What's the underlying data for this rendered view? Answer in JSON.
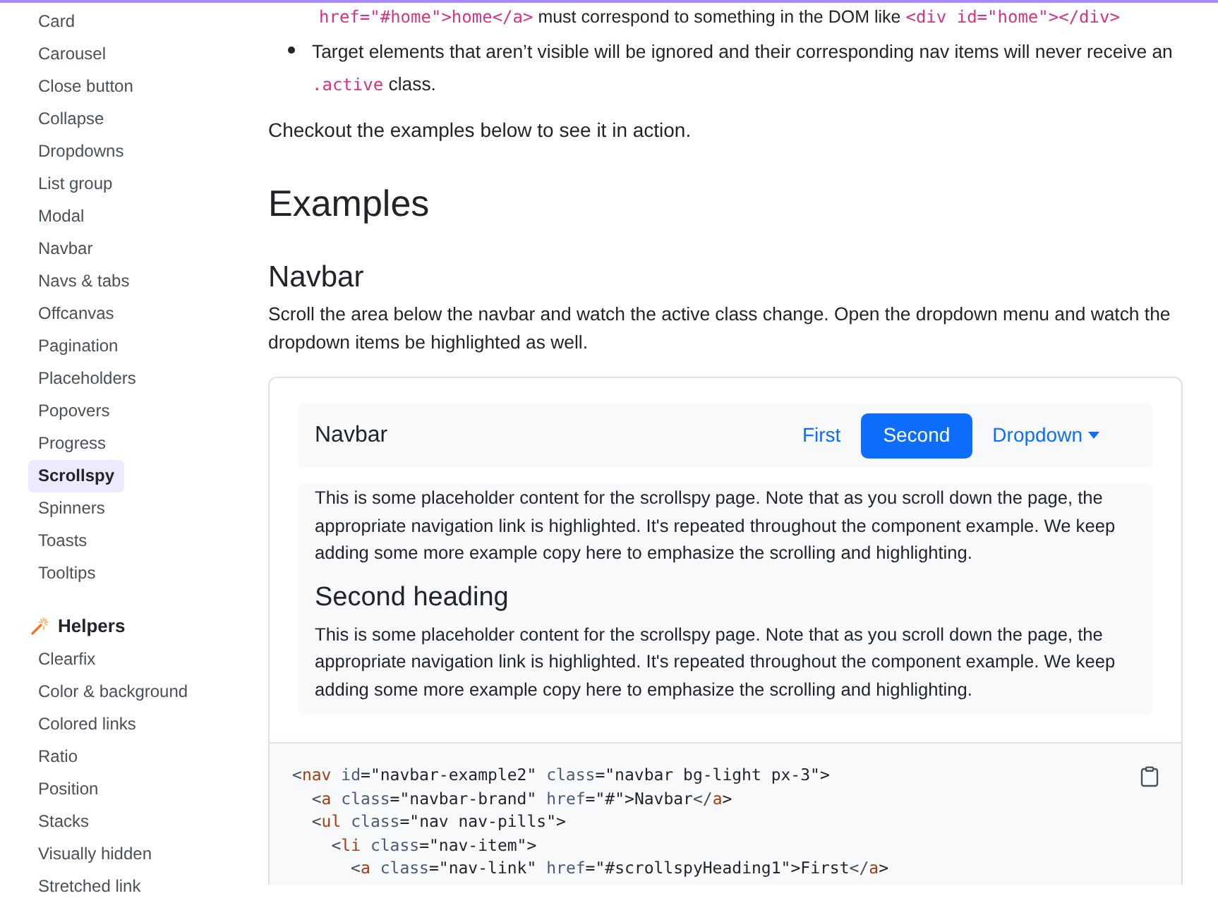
{
  "sidebar": {
    "items": [
      {
        "label": "Card",
        "selected": false
      },
      {
        "label": "Carousel",
        "selected": false
      },
      {
        "label": "Close button",
        "selected": false
      },
      {
        "label": "Collapse",
        "selected": false
      },
      {
        "label": "Dropdowns",
        "selected": false
      },
      {
        "label": "List group",
        "selected": false
      },
      {
        "label": "Modal",
        "selected": false
      },
      {
        "label": "Navbar",
        "selected": false
      },
      {
        "label": "Navs & tabs",
        "selected": false
      },
      {
        "label": "Offcanvas",
        "selected": false
      },
      {
        "label": "Pagination",
        "selected": false
      },
      {
        "label": "Placeholders",
        "selected": false
      },
      {
        "label": "Popovers",
        "selected": false
      },
      {
        "label": "Progress",
        "selected": false
      },
      {
        "label": "Scrollspy",
        "selected": true
      },
      {
        "label": "Spinners",
        "selected": false
      },
      {
        "label": "Toasts",
        "selected": false
      },
      {
        "label": "Tooltips",
        "selected": false
      }
    ],
    "section": {
      "title": "Helpers",
      "items": [
        {
          "label": "Clearfix",
          "selected": false
        },
        {
          "label": "Color & background",
          "selected": false
        },
        {
          "label": "Colored links",
          "selected": false
        },
        {
          "label": "Ratio",
          "selected": false
        },
        {
          "label": "Position",
          "selected": false
        },
        {
          "label": "Stacks",
          "selected": false
        },
        {
          "label": "Visually hidden",
          "selected": false
        },
        {
          "label": "Stretched link",
          "selected": false
        }
      ]
    }
  },
  "content": {
    "cut_line": [
      {
        "kind": "code",
        "text": "href=\"#home\">home</a>"
      },
      {
        "kind": "text",
        "text": " must correspond to something in the DOM like "
      },
      {
        "kind": "code",
        "text": "<div id=\"home\"></div>"
      }
    ],
    "bullet": [
      {
        "kind": "text",
        "text": "Target elements that aren’t visible will be ignored and their corresponding nav items will never receive an "
      },
      {
        "kind": "code",
        "text": ".active"
      },
      {
        "kind": "text",
        "text": " class."
      }
    ],
    "intro": "Checkout the examples below to see it in action.",
    "heading": "Examples",
    "subheading": "Navbar",
    "description": "Scroll the area below the navbar and watch the active class change. Open the dropdown menu and watch the dropdown items be highlighted as well.",
    "example": {
      "brand": "Navbar",
      "nav": [
        {
          "label": "First",
          "selected": false,
          "kind": "link"
        },
        {
          "label": "Second",
          "selected": true,
          "kind": "link"
        },
        {
          "label": "Dropdown",
          "selected": false,
          "kind": "dropdown"
        }
      ],
      "paragraph_1": "This is some placeholder content for the scrollspy page. Note that as you scroll down the page, the appropriate navigation link is highlighted. It's repeated throughout the component example. We keep adding some more example copy here to emphasize the scrolling and highlighting.",
      "heading_2": "Second heading",
      "paragraph_2": "This is some placeholder content for the scrollspy page. Note that as you scroll down the page, the appropriate navigation link is highlighted. It's repeated throughout the component example. We keep adding some more example copy here to emphasize the scrolling and highlighting."
    },
    "code": [
      "<nav id=\"navbar-example2\" class=\"navbar bg-light px-3\">",
      "  <a class=\"navbar-brand\" href=\"#\">Navbar</a>",
      "  <ul class=\"nav nav-pills\">",
      "    <li class=\"nav-item\">",
      "      <a class=\"nav-link\" href=\"#scrollspyHeading1\">First</a>"
    ]
  }
}
